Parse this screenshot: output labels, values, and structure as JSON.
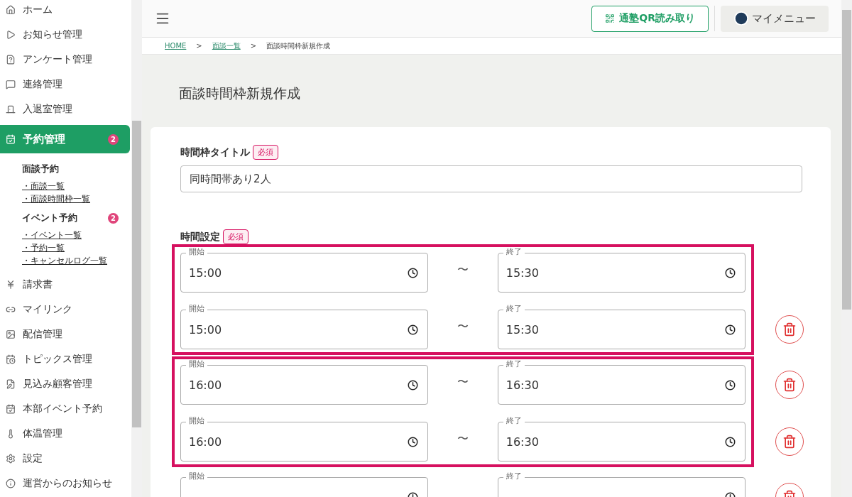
{
  "sidebar": {
    "items": [
      {
        "label": "ホーム",
        "selected": false
      },
      {
        "label": "お知らせ管理",
        "selected": false
      },
      {
        "label": "アンケート管理",
        "selected": false
      },
      {
        "label": "連絡管理",
        "selected": false
      },
      {
        "label": "入退室管理",
        "selected": false
      },
      {
        "label": "予約管理",
        "selected": true,
        "badge": "2",
        "sections": [
          {
            "heading": "面談予約",
            "links": [
              "・面談一覧",
              "・面談時間枠一覧"
            ]
          },
          {
            "heading": "イベント予約",
            "badge": "2",
            "links": [
              "・イベント一覧",
              "・予約一覧",
              "・キャンセルログ一覧"
            ]
          }
        ]
      },
      {
        "label": "請求書",
        "selected": false
      },
      {
        "label": "マイリンク",
        "selected": false
      },
      {
        "label": "配信管理",
        "selected": false
      },
      {
        "label": "トピックス管理",
        "selected": false
      },
      {
        "label": "見込み顧客管理",
        "selected": false
      },
      {
        "label": "本部イベント予約",
        "selected": false
      },
      {
        "label": "体温管理",
        "selected": false
      },
      {
        "label": "設定",
        "selected": false
      },
      {
        "label": "運営からのお知らせ",
        "selected": false
      }
    ]
  },
  "header": {
    "qr_button": "通塾QR読み取り",
    "my_menu": "マイメニュー"
  },
  "breadcrumb": [
    {
      "kind": "link",
      "text": "HOME"
    },
    {
      "kind": "separator",
      "text": ">"
    },
    {
      "kind": "link",
      "text": "面談一覧"
    },
    {
      "kind": "separator",
      "text": ">"
    },
    {
      "kind": "current",
      "text": "面談時間枠新規作成"
    }
  ],
  "page_title": "面談時間枠新規作成",
  "form": {
    "title_field": {
      "label": "時間枠タイトル",
      "required": "必須",
      "value": "同時間帯あり2人"
    },
    "time_settings": {
      "label": "時間設定",
      "required": "必須",
      "groups": [
        {
          "highlighted": true,
          "rows": [
            {
              "start_label": "開始",
              "start": "15:00",
              "tilde": "〜",
              "end_label": "終了",
              "end": "15:30",
              "deletable": false
            },
            {
              "start_label": "開始",
              "start": "15:00",
              "tilde": "〜",
              "end_label": "終了",
              "end": "15:30",
              "deletable": true
            }
          ]
        },
        {
          "highlighted": true,
          "rows": [
            {
              "start_label": "開始",
              "start": "16:00",
              "tilde": "〜",
              "end_label": "終了",
              "end": "16:30",
              "deletable": true
            },
            {
              "start_label": "開始",
              "start": "16:00",
              "tilde": "〜",
              "end_label": "終了",
              "end": "16:30",
              "deletable": true
            }
          ]
        },
        {
          "highlighted": false,
          "rows": [
            {
              "start_label": "開始",
              "end_label": "終了",
              "deletable": true
            }
          ]
        }
      ]
    }
  }
}
